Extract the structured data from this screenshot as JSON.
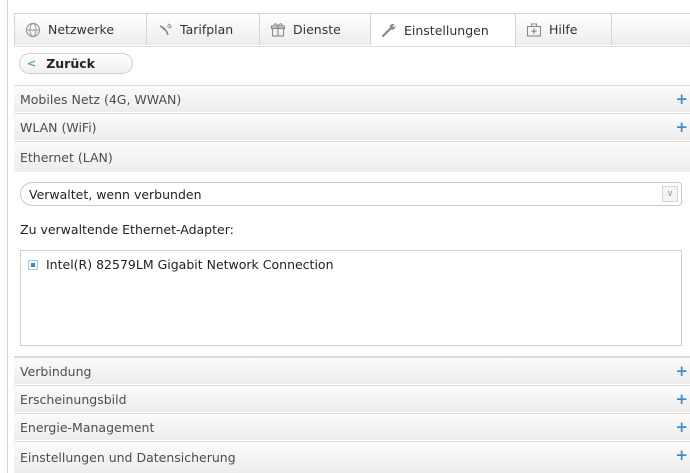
{
  "tabs": [
    {
      "label": "Netzwerke",
      "icon": "globe-icon"
    },
    {
      "label": "Tarifplan",
      "icon": "satellite-dish-icon"
    },
    {
      "label": "Dienste",
      "icon": "gift-icon"
    },
    {
      "label": "Einstellungen",
      "icon": "wrench-icon",
      "active": true
    },
    {
      "label": "Hilfe",
      "icon": "first-aid-kit-icon"
    }
  ],
  "back_button": {
    "label": "Zurück",
    "icon": "chevron-left-icon"
  },
  "sections_top": [
    {
      "label": "Mobiles Netz (4G, WWAN)",
      "expand": "+"
    },
    {
      "label": "WLAN (WiFi)",
      "expand": "+"
    }
  ],
  "ethernet": {
    "header": "Ethernet (LAN)",
    "select_value": "Verwaltet, wenn verbunden",
    "adapters_label": "Zu verwaltende Ethernet-Adapter:",
    "adapters": [
      {
        "name": "Intel(R) 82579LM Gigabit Network Connection",
        "checked": true
      }
    ]
  },
  "sections_bottom": [
    {
      "label": "Verbindung",
      "expand": "+"
    },
    {
      "label": "Erscheinungsbild",
      "expand": "+"
    },
    {
      "label": "Energie-Management",
      "expand": "+"
    },
    {
      "label": "Einstellungen und Datensicherung",
      "expand": "+"
    }
  ],
  "colors": {
    "accent": "#3a8fd2",
    "checkbox_fill": "#2f8ad1"
  }
}
